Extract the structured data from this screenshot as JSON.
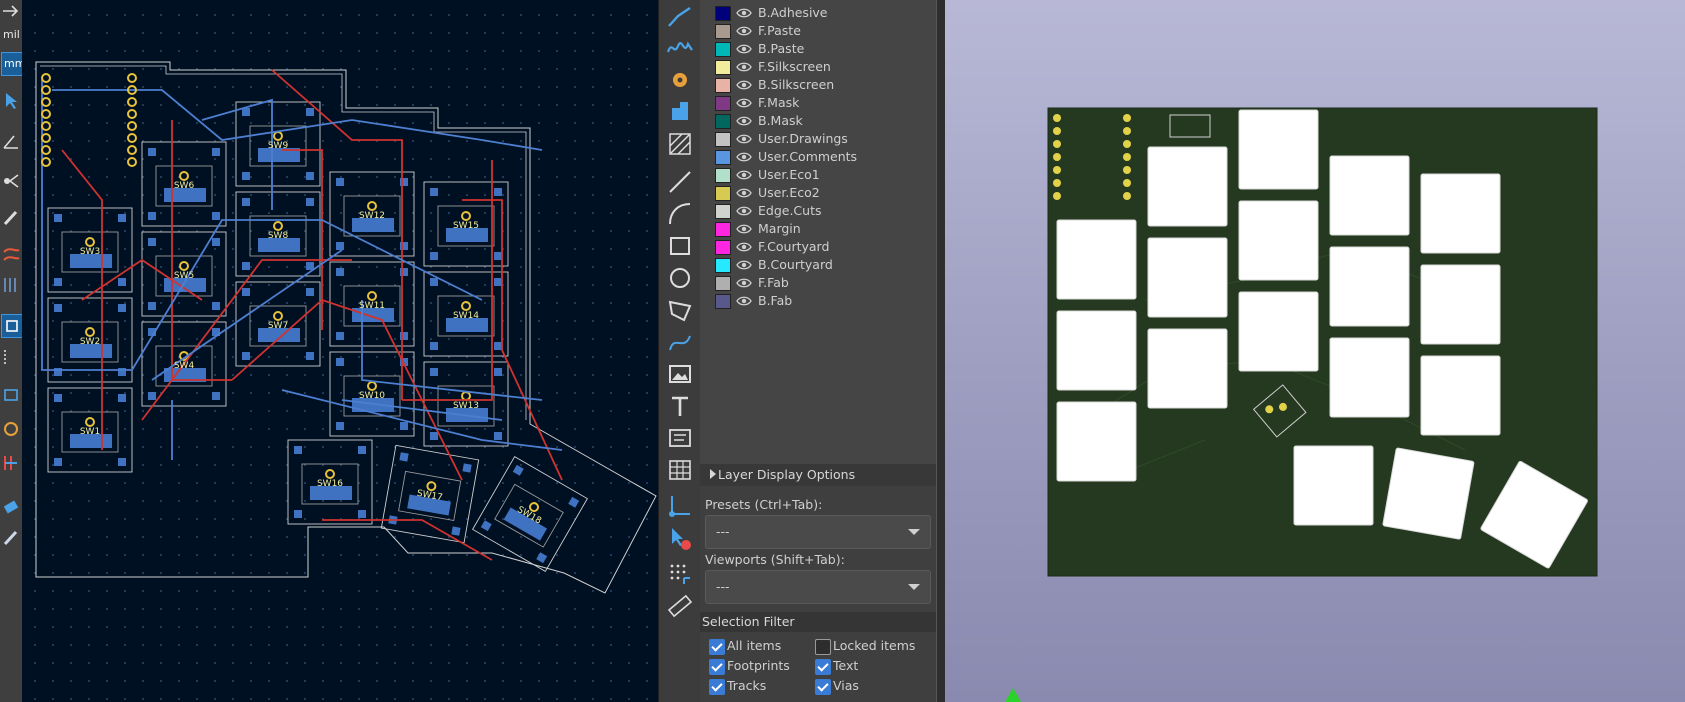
{
  "left_toolbar": {
    "units_label": "mil",
    "units_mm_label": "mm"
  },
  "draw_toolbar": {
    "tools": [
      "route-track",
      "route-diff-pair",
      "add-via",
      "add-pad",
      "add-zone",
      "draw-line",
      "draw-arc",
      "draw-rectangle",
      "draw-circle",
      "draw-polygon",
      "draw-bezier",
      "add-image",
      "add-text",
      "add-textbox",
      "add-table",
      "set-origin",
      "delete-tool",
      "grid-origin",
      "measure"
    ]
  },
  "layers": [
    {
      "name": "B.Adhesive",
      "color": "#00007a"
    },
    {
      "name": "F.Paste",
      "color": "#a89a8e"
    },
    {
      "name": "B.Paste",
      "color": "#00b6b6"
    },
    {
      "name": "F.Silkscreen",
      "color": "#f2ed9c"
    },
    {
      "name": "B.Silkscreen",
      "color": "#e8b2a6"
    },
    {
      "name": "F.Mask",
      "color": "#803a85"
    },
    {
      "name": "B.Mask",
      "color": "#02685f"
    },
    {
      "name": "User.Drawings",
      "color": "#c2c2c2"
    },
    {
      "name": "User.Comments",
      "color": "#5a96e0"
    },
    {
      "name": "User.Eco1",
      "color": "#b2dfca"
    },
    {
      "name": "User.Eco2",
      "color": "#d6ca52"
    },
    {
      "name": "Edge.Cuts",
      "color": "#d0d2cd"
    },
    {
      "name": "Margin",
      "color": "#ff26e2"
    },
    {
      "name": "F.Courtyard",
      "color": "#ff26e2"
    },
    {
      "name": "B.Courtyard",
      "color": "#26e9ff"
    },
    {
      "name": "F.Fab",
      "color": "#afafaf"
    },
    {
      "name": "B.Fab",
      "color": "#58588a"
    }
  ],
  "panel": {
    "layer_display_options": "Layer Display Options",
    "presets_label": "Presets (Ctrl+Tab):",
    "presets_value": "---",
    "viewports_label": "Viewports (Shift+Tab):",
    "viewports_value": "---",
    "selection_filter": "Selection Filter"
  },
  "selection_filter": {
    "all_items": {
      "label": "All items",
      "checked": true
    },
    "locked_items": {
      "label": "Locked items",
      "checked": false
    },
    "footprints": {
      "label": "Footprints",
      "checked": true
    },
    "text": {
      "label": "Text",
      "checked": true
    },
    "tracks": {
      "label": "Tracks",
      "checked": true
    },
    "vias": {
      "label": "Vias",
      "checked": true
    }
  },
  "pcb": {
    "switch_labels": [
      "SW1",
      "SW2",
      "SW3",
      "SW4",
      "SW5",
      "SW6",
      "SW7",
      "SW8",
      "SW9",
      "SW10",
      "SW11",
      "SW12",
      "SW13",
      "SW14",
      "SW15",
      "SW16",
      "SW17",
      "SW18"
    ]
  }
}
